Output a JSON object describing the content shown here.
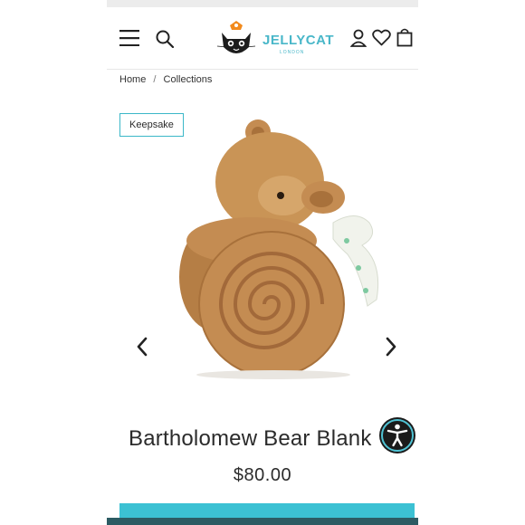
{
  "header": {
    "logo_text": "JELLYCAT",
    "logo_subtext": "LONDON",
    "icons": [
      "menu-icon",
      "search-icon",
      "account-icon",
      "heart-icon",
      "bag-icon"
    ]
  },
  "breadcrumb": {
    "home": "Home",
    "separator": "/",
    "current": "Collections"
  },
  "product": {
    "badge": "Keepsake",
    "title": "Bartholomew Bear Blank",
    "price": "$80.00"
  },
  "colors": {
    "accent": "#3cc1d3",
    "text": "#2b2b2b",
    "footer_bar": "#2c5b63"
  }
}
